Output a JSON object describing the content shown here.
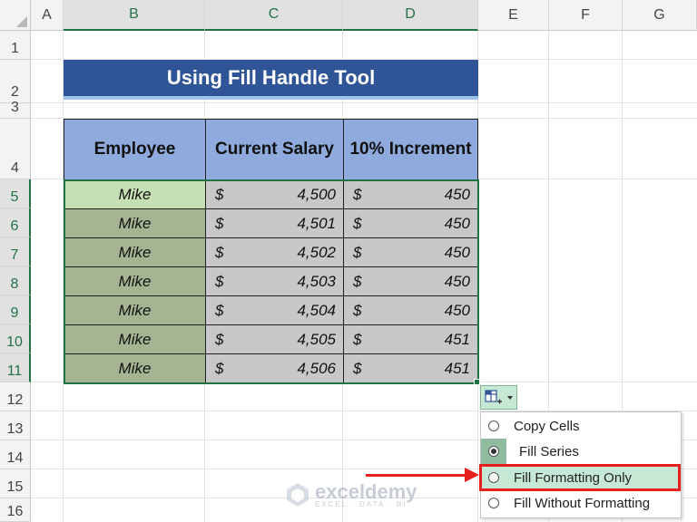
{
  "columns": [
    "A",
    "B",
    "C",
    "D",
    "E",
    "F",
    "G"
  ],
  "rows": [
    "1",
    "2",
    "3",
    "4",
    "5",
    "6",
    "7",
    "8",
    "9",
    "10",
    "11",
    "12",
    "13",
    "14",
    "15",
    "16"
  ],
  "title": "Using Fill Handle Tool",
  "table": {
    "headers": [
      "Employee",
      "Current Salary",
      "10% Increment"
    ],
    "rows": [
      {
        "employee": "Mike",
        "salary": "4,500",
        "increment": "450"
      },
      {
        "employee": "Mike",
        "salary": "4,501",
        "increment": "450"
      },
      {
        "employee": "Mike",
        "salary": "4,502",
        "increment": "450"
      },
      {
        "employee": "Mike",
        "salary": "4,503",
        "increment": "450"
      },
      {
        "employee": "Mike",
        "salary": "4,504",
        "increment": "450"
      },
      {
        "employee": "Mike",
        "salary": "4,505",
        "increment": "451"
      },
      {
        "employee": "Mike",
        "salary": "4,506",
        "increment": "451"
      }
    ],
    "currency_symbol": "$"
  },
  "autofill_menu": {
    "items": [
      {
        "label": "Copy Cells",
        "state": "unselected"
      },
      {
        "label": "Fill Series",
        "state": "selected"
      },
      {
        "label": "Fill Formatting Only",
        "state": "highlighted"
      },
      {
        "label": "Fill Without Formatting",
        "state": "unselected"
      }
    ]
  },
  "watermark": {
    "name": "exceldemy",
    "tagline": "EXCEL · DATA · BI"
  },
  "colors": {
    "title_bg": "#2f5597",
    "header_bg": "#8faadc",
    "employee_bg": "#a5b594",
    "salary_bg": "#c8c8c8",
    "selection": "#217346",
    "annotation": "#e81f1f"
  }
}
